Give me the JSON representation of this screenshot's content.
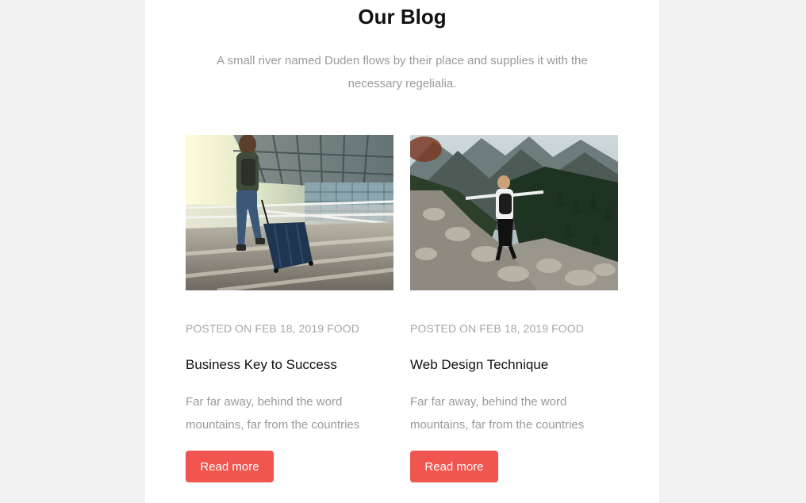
{
  "blog": {
    "title": "Our Blog",
    "intro": "A small river named Duden flows by their place and supplies it with the necessary regelialia."
  },
  "posts": [
    {
      "meta": "POSTED ON FEB 18, 2019 FOOD",
      "title": "Business Key to Success",
      "excerpt": "Far far away, behind the word mountains, far from the countries",
      "button_label": "Read more",
      "image_alt": "Traveler with suitcase at station"
    },
    {
      "meta": "POSTED ON FEB 18, 2019 FOOD",
      "title": "Web Design Technique",
      "excerpt": "Far far away, behind the word mountains, far from the countries",
      "button_label": "Read more",
      "image_alt": "Hiker on a rocky mountain trail"
    }
  ],
  "colors": {
    "page_background": "#f1f1f1",
    "panel_background": "#ffffff",
    "accent": "#f0554f",
    "heading": "#111111",
    "muted_text": "#9a9a9a"
  }
}
